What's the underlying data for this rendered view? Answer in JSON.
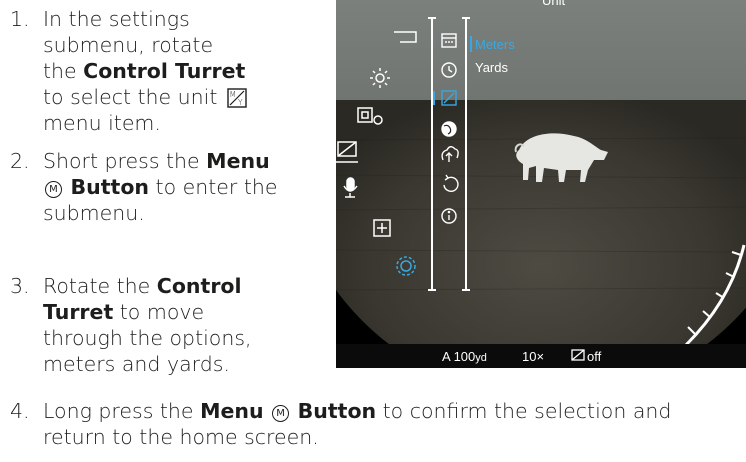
{
  "steps": [
    {
      "num": "1.",
      "lines": [
        "In the settings",
        "submenu, rotate",
        "the ",
        "Control Turret",
        "to select the unit ",
        "menu item."
      ]
    },
    {
      "num": "2.",
      "a": "Short press the ",
      "b": "Menu",
      "c": "M",
      "d": "Button",
      "e": " to enter the",
      "f": "submenu."
    },
    {
      "num": "3.",
      "a": "Rotate the ",
      "b": "Control",
      "c": "Turret",
      "d": " to move",
      "e": "through the options,",
      "f": "meters and yards."
    },
    {
      "num": "4.",
      "a": "Long press the ",
      "b": "Menu",
      "c": "M",
      "d": "Button",
      "e": " to confirm the selection and",
      "f": "return to the home screen."
    }
  ],
  "screen": {
    "menu_title": "Unit",
    "options": [
      "Meters",
      "Yards"
    ],
    "selected_option": "Meters",
    "status_bar": {
      "range": "A 100",
      "range_unit": "yd",
      "zoom": "10×",
      "display": "off"
    },
    "left_icons": [
      "bracket-icon",
      "brightness-icon",
      "pip-icon",
      "display-off-icon",
      "microphone-icon",
      "plus-box-icon",
      "gear-icon"
    ],
    "submenu_icons": [
      "calendar-icon",
      "clock-icon",
      "unit-icon",
      "globe-icon",
      "cloud-upload-icon",
      "reset-icon",
      "info-icon"
    ],
    "colors": {
      "accent": "#3aa8e0",
      "hud": "#ffffff"
    }
  }
}
